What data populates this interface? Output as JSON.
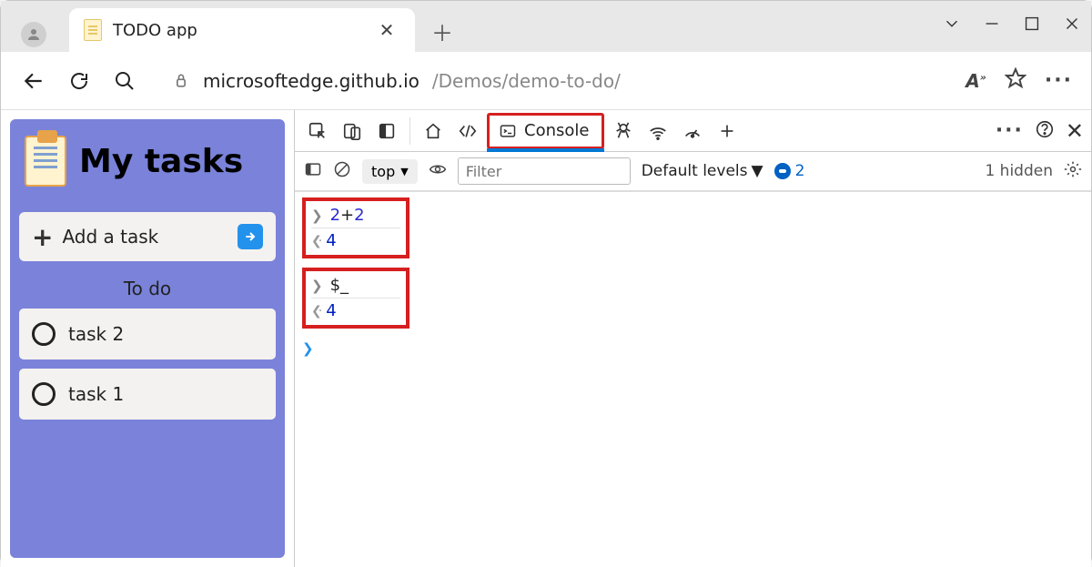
{
  "browser": {
    "tab_title": "TODO app",
    "url_host": "microsoftedge.github.io",
    "url_path": "/Demos/demo-to-do/"
  },
  "page": {
    "title": "My tasks",
    "add_task_label": "Add a task",
    "section": "To do",
    "tasks": [
      "task 2",
      "task 1"
    ]
  },
  "devtools": {
    "console_tab_label": "Console",
    "context": "top",
    "filter_placeholder": "Filter",
    "levels_label": "Default levels",
    "issues_count": "2",
    "hidden_label": "1 hidden",
    "outputs": {
      "g1_in": "2+2",
      "g1_in_a": "2",
      "g1_in_op": "+",
      "g1_in_b": "2",
      "g1_out": "4",
      "g2_in": "$_",
      "g2_out": "4"
    }
  }
}
